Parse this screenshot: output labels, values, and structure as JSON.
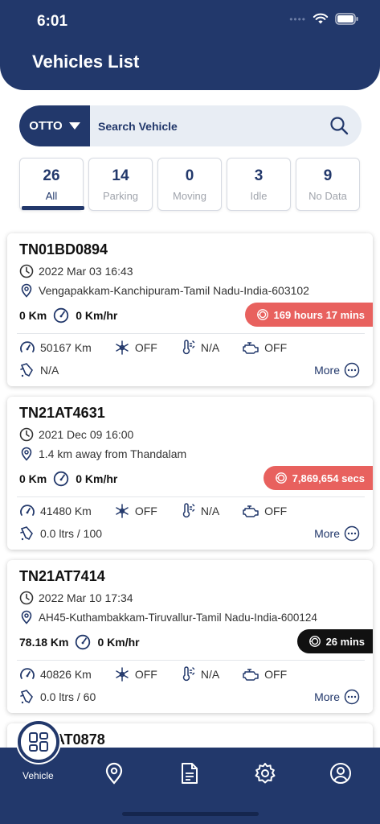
{
  "status_bar": {
    "time": "6:01"
  },
  "header": {
    "title": "Vehicles List"
  },
  "search": {
    "selected": "OTTO",
    "placeholder": "Search Vehicle"
  },
  "stats": [
    {
      "count": "26",
      "label": "All"
    },
    {
      "count": "14",
      "label": "Parking"
    },
    {
      "count": "0",
      "label": "Moving"
    },
    {
      "count": "3",
      "label": "Idle"
    },
    {
      "count": "9",
      "label": "No Data"
    }
  ],
  "vehicles": [
    {
      "plate": "TN01BD0894",
      "datetime": "2022 Mar 03 16:43",
      "location": "Vengapakkam-Kanchipuram-Tamil Nadu-India-603102",
      "distance": "0 Km",
      "speed": "0 Km/hr",
      "badge": "169 hours 17 mins",
      "odometer": "50167 Km",
      "ac": "OFF",
      "temp": "N/A",
      "engine": "OFF",
      "fuel": "N/A",
      "more_label": "More"
    },
    {
      "plate": "TN21AT4631",
      "datetime": "2021 Dec 09 16:00",
      "location": "1.4 km away from Thandalam",
      "distance": "0 Km",
      "speed": "0 Km/hr",
      "badge": "7,869,654 secs",
      "odometer": "41480 Km",
      "ac": "OFF",
      "temp": "N/A",
      "engine": "OFF",
      "fuel": "0.0 ltrs / 100",
      "more_label": "More"
    },
    {
      "plate": "TN21AT7414",
      "datetime": "2022 Mar 10 17:34",
      "location": "AH45-Kuthambakkam-Tiruvallur-Tamil Nadu-India-600124",
      "distance": "78.18 Km",
      "speed": "0 Km/hr",
      "badge": "26 mins",
      "odometer": "40826 Km",
      "ac": "OFF",
      "temp": "N/A",
      "engine": "OFF",
      "fuel": "0.0 ltrs / 60",
      "more_label": "More"
    },
    {
      "plate": "TN21AT0878"
    }
  ],
  "tabbar": {
    "vehicle_label": "Vehicle"
  },
  "colors": {
    "primary": "#22386b",
    "badge_red": "#e8615e",
    "badge_black": "#111111"
  }
}
